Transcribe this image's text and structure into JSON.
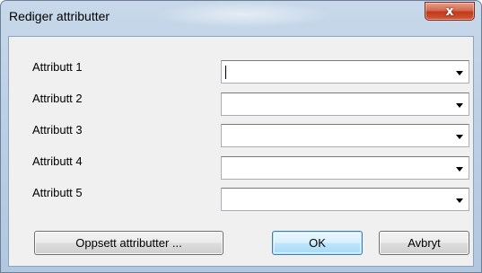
{
  "window": {
    "title": "Rediger attributter",
    "close_glyph": "x"
  },
  "fields": [
    {
      "label": "Attributt 1",
      "value": "",
      "focused": true
    },
    {
      "label": "Attributt 2",
      "value": "",
      "focused": false
    },
    {
      "label": "Attributt 3",
      "value": "",
      "focused": false
    },
    {
      "label": "Attributt 4",
      "value": "",
      "focused": false
    },
    {
      "label": "Attributt 5",
      "value": "",
      "focused": false
    }
  ],
  "buttons": {
    "setup_label": "Oppsett attributter ...",
    "ok_label": "OK",
    "cancel_label": "Avbryt"
  },
  "icons": {
    "close": "close-icon",
    "dropdown": "chevron-down-icon"
  },
  "colors": {
    "close_button": "#c2391c",
    "default_button_border": "#3c7fb1",
    "dialog_background": "#f0f0f0"
  }
}
